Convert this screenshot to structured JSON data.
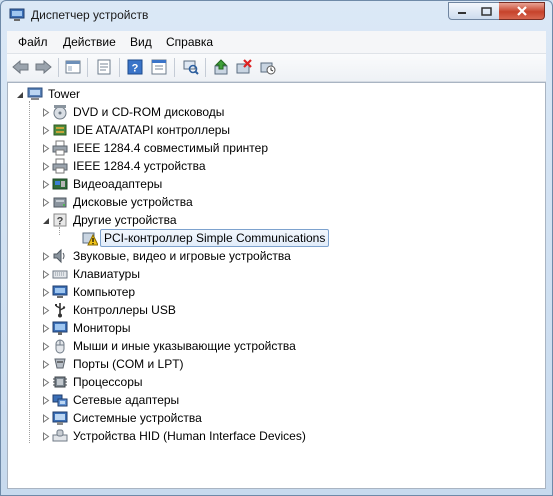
{
  "window": {
    "title": "Диспетчер устройств"
  },
  "menu": {
    "file": "Файл",
    "action": "Действие",
    "view": "Вид",
    "help": "Справка"
  },
  "tree": {
    "root": "Tower",
    "items": [
      "DVD и CD-ROM дисководы",
      "IDE ATA/ATAPI контроллеры",
      "IEEE 1284.4 совместимый принтер",
      "IEEE 1284.4 устройства",
      "Видеоадаптеры",
      "Дисковые устройства",
      "Другие устройства",
      "PCI-контроллер Simple Communications",
      "Звуковые, видео и игровые устройства",
      "Клавиатуры",
      "Компьютер",
      "Контроллеры USB",
      "Мониторы",
      "Мыши и иные указывающие устройства",
      "Порты (COM и LPT)",
      "Процессоры",
      "Сетевые адаптеры",
      "Системные устройства",
      "Устройства HID (Human Interface Devices)"
    ]
  },
  "colors": {
    "accent": "#2b6cc4",
    "selection_border": "#7da2ce",
    "warning": "#f0c419"
  }
}
